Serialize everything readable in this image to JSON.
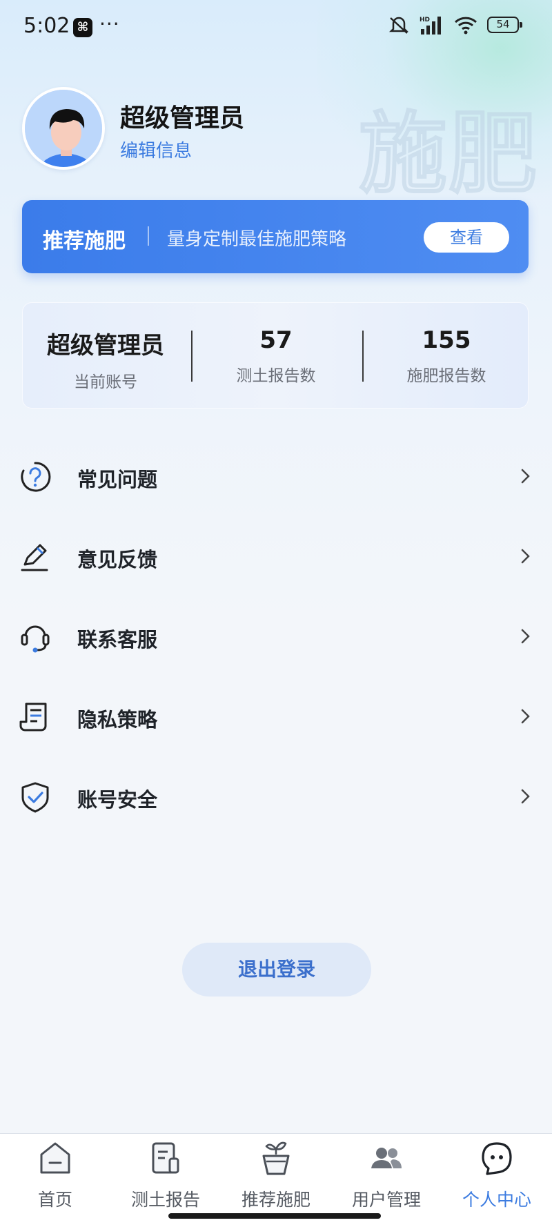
{
  "status_bar": {
    "time": "5:02",
    "battery": "54",
    "network": "HD"
  },
  "profile": {
    "name": "超级管理员",
    "edit_label": "编辑信息"
  },
  "watermark": "施肥",
  "banner": {
    "title": "推荐施肥",
    "subtitle": "量身定制最佳施肥策略",
    "button": "查看"
  },
  "stats": [
    {
      "value": "超级管理员",
      "label": "当前账号"
    },
    {
      "value": "57",
      "label": "测土报告数"
    },
    {
      "value": "155",
      "label": "施肥报告数"
    }
  ],
  "menu": [
    {
      "label": "常见问题",
      "icon": "question-icon"
    },
    {
      "label": "意见反馈",
      "icon": "pencil-icon"
    },
    {
      "label": "联系客服",
      "icon": "headset-icon"
    },
    {
      "label": "隐私策略",
      "icon": "document-icon"
    },
    {
      "label": "账号安全",
      "icon": "shield-check-icon"
    }
  ],
  "logout": "退出登录",
  "tabbar": [
    {
      "label": "首页",
      "icon": "home-icon",
      "active": false
    },
    {
      "label": "测土报告",
      "icon": "report-icon",
      "active": false
    },
    {
      "label": "推荐施肥",
      "icon": "plant-pot-icon",
      "active": false
    },
    {
      "label": "用户管理",
      "icon": "users-icon",
      "active": false
    },
    {
      "label": "个人中心",
      "icon": "profile-icon",
      "active": true
    }
  ],
  "colors": {
    "accent": "#3b7be0",
    "banner": "#4a87ee",
    "text": "#1f2329"
  }
}
